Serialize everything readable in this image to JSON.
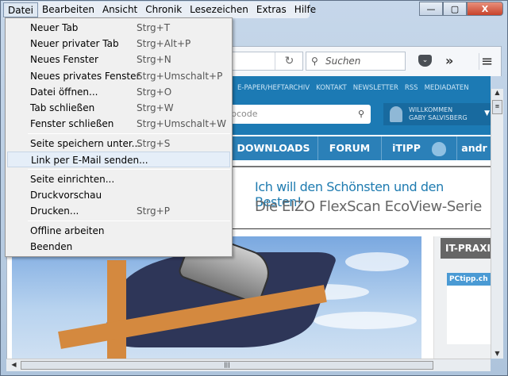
{
  "menubar": [
    "Datei",
    "Bearbeiten",
    "Ansicht",
    "Chronik",
    "Lesezeichen",
    "Extras",
    "Hilfe"
  ],
  "window": {
    "minimize": "—",
    "maximize": "▢",
    "close": "X"
  },
  "toolbar": {
    "reload": "↻",
    "search_placeholder": "Suchen",
    "overflow": "»",
    "menu": "≡"
  },
  "site": {
    "toplinks": [
      "E-PAPER/HEFTARCHIV",
      "KONTAKT",
      "NEWSLETTER",
      "RSS",
      "MEDIADATEN"
    ],
    "search_value": "bcode",
    "user_line1": "WILLKOMMEN",
    "user_line2": "GABY SALVISBERG",
    "nav": [
      "DOWNLOADS",
      "FORUM",
      "iTIPP",
      "andr"
    ],
    "ad_line1": "Ich will den Schönsten und den Besten!",
    "ad_line2": "Die EIZO FlexScan EcoView-Serie",
    "sidebar_title": "IT-PRAXIS",
    "thumb_logo": "PCtipp.ch"
  },
  "file_menu": [
    {
      "label": "Neuer Tab",
      "shortcut": "Strg+T"
    },
    {
      "label": "Neuer privater Tab",
      "shortcut": "Strg+Alt+P"
    },
    {
      "label": "Neues Fenster",
      "shortcut": "Strg+N"
    },
    {
      "label": "Neues privates Fenster",
      "shortcut": "Strg+Umschalt+P"
    },
    {
      "label": "Datei öffnen...",
      "shortcut": "Strg+O"
    },
    {
      "label": "Tab schließen",
      "shortcut": "Strg+W"
    },
    {
      "label": "Fenster schließen",
      "shortcut": "Strg+Umschalt+W"
    },
    {
      "label": "Seite speichern unter...",
      "shortcut": "Strg+S"
    },
    {
      "label": "Link per E-Mail senden...",
      "shortcut": ""
    },
    {
      "label": "Seite einrichten...",
      "shortcut": ""
    },
    {
      "label": "Druckvorschau",
      "shortcut": ""
    },
    {
      "label": "Drucken...",
      "shortcut": "Strg+P"
    },
    {
      "label": "Offline arbeiten",
      "shortcut": ""
    },
    {
      "label": "Beenden",
      "shortcut": ""
    }
  ]
}
